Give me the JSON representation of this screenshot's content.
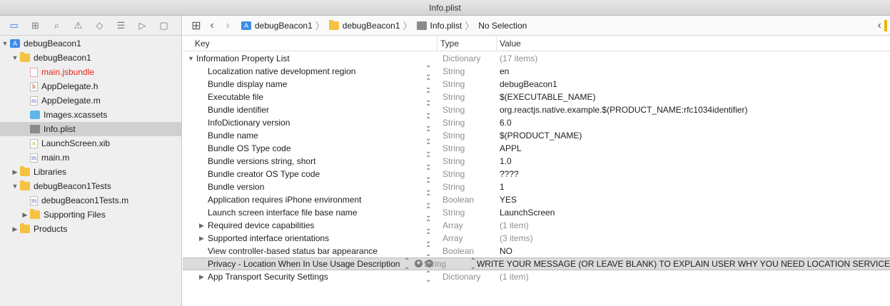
{
  "window": {
    "title": "Info.plist"
  },
  "navigator": {
    "tabs": [
      {
        "name": "project-navigator-icon",
        "glyph": "▭",
        "active": true
      },
      {
        "name": "symbol-navigator-icon",
        "glyph": "⊞",
        "active": false
      },
      {
        "name": "find-navigator-icon",
        "glyph": "⌕",
        "active": false
      },
      {
        "name": "issue-navigator-icon",
        "glyph": "⚠",
        "active": false
      },
      {
        "name": "test-navigator-icon",
        "glyph": "◇",
        "active": false
      },
      {
        "name": "debug-navigator-icon",
        "glyph": "☰",
        "active": false
      },
      {
        "name": "breakpoint-navigator-icon",
        "glyph": "▷",
        "active": false
      },
      {
        "name": "report-navigator-icon",
        "glyph": "▢",
        "active": false
      }
    ],
    "tree": [
      {
        "label": "debugBeacon1",
        "indent": 0,
        "disclosure": "open",
        "icon": "project",
        "selected": false,
        "red": false
      },
      {
        "label": "debugBeacon1",
        "indent": 1,
        "disclosure": "open",
        "icon": "folder",
        "selected": false,
        "red": false
      },
      {
        "label": "main.jsbundle",
        "indent": 2,
        "disclosure": "",
        "icon": "file-blank",
        "selected": false,
        "red": true
      },
      {
        "label": "AppDelegate.h",
        "indent": 2,
        "disclosure": "",
        "icon": "file-h",
        "selected": false,
        "red": false
      },
      {
        "label": "AppDelegate.m",
        "indent": 2,
        "disclosure": "",
        "icon": "file-m",
        "selected": false,
        "red": false
      },
      {
        "label": "Images.xcassets",
        "indent": 2,
        "disclosure": "",
        "icon": "assets",
        "selected": false,
        "red": false
      },
      {
        "label": "Info.plist",
        "indent": 2,
        "disclosure": "",
        "icon": "plist",
        "selected": true,
        "red": false
      },
      {
        "label": "LaunchScreen.xib",
        "indent": 2,
        "disclosure": "",
        "icon": "file-xib",
        "selected": false,
        "red": false
      },
      {
        "label": "main.m",
        "indent": 2,
        "disclosure": "",
        "icon": "file-m",
        "selected": false,
        "red": false
      },
      {
        "label": "Libraries",
        "indent": 1,
        "disclosure": "closed",
        "icon": "folder",
        "selected": false,
        "red": false
      },
      {
        "label": "debugBeacon1Tests",
        "indent": 1,
        "disclosure": "open",
        "icon": "folder",
        "selected": false,
        "red": false
      },
      {
        "label": "debugBeacon1Tests.m",
        "indent": 2,
        "disclosure": "",
        "icon": "file-m",
        "selected": false,
        "red": false
      },
      {
        "label": "Supporting Files",
        "indent": 2,
        "disclosure": "closed",
        "icon": "folder",
        "selected": false,
        "red": false
      },
      {
        "label": "Products",
        "indent": 1,
        "disclosure": "closed",
        "icon": "folder",
        "selected": false,
        "red": false
      }
    ]
  },
  "jumpbar": {
    "crumbs": [
      {
        "label": "debugBeacon1",
        "icon": "project"
      },
      {
        "label": "debugBeacon1",
        "icon": "folder"
      },
      {
        "label": "Info.plist",
        "icon": "plist"
      }
    ],
    "tail": "No Selection"
  },
  "plist": {
    "headers": {
      "key": "Key",
      "type": "Type",
      "value": "Value"
    },
    "rows": [
      {
        "key": "Information Property List",
        "type": "Dictionary",
        "value": "(17 items)",
        "level": 0,
        "disclosure": "open",
        "value_dim": true,
        "selected": false
      },
      {
        "key": "Localization native development region",
        "type": "String",
        "value": "en",
        "level": 1,
        "disclosure": "",
        "value_dim": false,
        "selected": false
      },
      {
        "key": "Bundle display name",
        "type": "String",
        "value": "debugBeacon1",
        "level": 1,
        "disclosure": "",
        "value_dim": false,
        "selected": false
      },
      {
        "key": "Executable file",
        "type": "String",
        "value": "$(EXECUTABLE_NAME)",
        "level": 1,
        "disclosure": "",
        "value_dim": false,
        "selected": false
      },
      {
        "key": "Bundle identifier",
        "type": "String",
        "value": "org.reactjs.native.example.$(PRODUCT_NAME:rfc1034identifier)",
        "level": 1,
        "disclosure": "",
        "value_dim": false,
        "selected": false
      },
      {
        "key": "InfoDictionary version",
        "type": "String",
        "value": "6.0",
        "level": 1,
        "disclosure": "",
        "value_dim": false,
        "selected": false
      },
      {
        "key": "Bundle name",
        "type": "String",
        "value": "$(PRODUCT_NAME)",
        "level": 1,
        "disclosure": "",
        "value_dim": false,
        "selected": false
      },
      {
        "key": "Bundle OS Type code",
        "type": "String",
        "value": "APPL",
        "level": 1,
        "disclosure": "",
        "value_dim": false,
        "selected": false
      },
      {
        "key": "Bundle versions string, short",
        "type": "String",
        "value": "1.0",
        "level": 1,
        "disclosure": "",
        "value_dim": false,
        "selected": false
      },
      {
        "key": "Bundle creator OS Type code",
        "type": "String",
        "value": "????",
        "level": 1,
        "disclosure": "",
        "value_dim": false,
        "selected": false
      },
      {
        "key": "Bundle version",
        "type": "String",
        "value": "1",
        "level": 1,
        "disclosure": "",
        "value_dim": false,
        "selected": false
      },
      {
        "key": "Application requires iPhone environment",
        "type": "Boolean",
        "value": "YES",
        "level": 1,
        "disclosure": "",
        "value_dim": false,
        "selected": false
      },
      {
        "key": "Launch screen interface file base name",
        "type": "String",
        "value": "LaunchScreen",
        "level": 1,
        "disclosure": "",
        "value_dim": false,
        "selected": false
      },
      {
        "key": "Required device capabilities",
        "type": "Array",
        "value": "(1 item)",
        "level": 1,
        "disclosure": "closed",
        "value_dim": true,
        "selected": false
      },
      {
        "key": "Supported interface orientations",
        "type": "Array",
        "value": "(3 items)",
        "level": 1,
        "disclosure": "closed",
        "value_dim": true,
        "selected": false
      },
      {
        "key": "View controller-based status bar appearance",
        "type": "Boolean",
        "value": "NO",
        "level": 1,
        "disclosure": "",
        "value_dim": false,
        "selected": false
      },
      {
        "key": "Privacy - Location When In Use Usage Description",
        "type": "String",
        "value": "WRITE YOUR MESSAGE (OR LEAVE BLANK) TO EXPLAIN USER WHY YOU NEED LOCATION SERVICE",
        "level": 1,
        "disclosure": "",
        "value_dim": false,
        "selected": true
      },
      {
        "key": "App Transport Security Settings",
        "type": "Dictionary",
        "value": "(1 item)",
        "level": 1,
        "disclosure": "closed",
        "value_dim": true,
        "selected": false
      }
    ]
  },
  "glyphs": {
    "open": "▼",
    "closed": "▶",
    "stepper": "⌃⌄",
    "add": "+",
    "remove": "−"
  },
  "colors": {
    "accent": "#2d7ef7",
    "selection": "#d0d0d0",
    "missing_file": "#e0281e",
    "folder": "#f6c243"
  }
}
